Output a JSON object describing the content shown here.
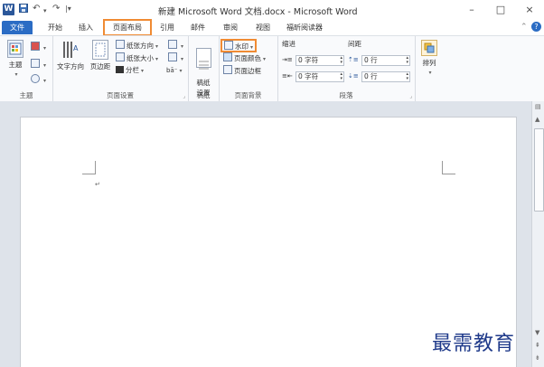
{
  "window": {
    "app_icon": "W",
    "title": "新建 Microsoft Word 文档.docx - Microsoft Word",
    "controls": {
      "minimize": "–",
      "maximize": "□",
      "close": "×"
    },
    "quick_access": {
      "save_icon": "save-icon",
      "undo": "↶",
      "dropdown": "|▾"
    }
  },
  "tabs": [
    {
      "label": "文件"
    },
    {
      "label": "开始"
    },
    {
      "label": "插入"
    },
    {
      "label": "页面布局"
    },
    {
      "label": "引用"
    },
    {
      "label": "邮件"
    },
    {
      "label": "审阅"
    },
    {
      "label": "视图"
    },
    {
      "label": "福昕阅读器"
    }
  ],
  "tab_right": {
    "collapse": "⌃",
    "help": "?"
  },
  "ribbon": {
    "theme": {
      "label": "主题",
      "button": "主题"
    },
    "page_setup": {
      "label": "页面设置",
      "text_direction": "文字方向",
      "margins": "页边距",
      "orientation": "纸张方向",
      "size": "纸张大小",
      "columns": "分栏"
    },
    "draft": {
      "label": "稿纸",
      "button": "稿纸\n设置"
    },
    "background": {
      "label": "页面背景",
      "watermark": "水印",
      "page_color": "页面颜色",
      "page_border": "页面边框"
    },
    "paragraph": {
      "label": "段落",
      "indent_title": "缩进",
      "spacing_title": "间距",
      "indent_left": "0 字符",
      "indent_right": "0 字符",
      "spacing_before": "0 行",
      "spacing_after": "0 行"
    },
    "arrange": {
      "button": "排列"
    }
  },
  "brand_text": "最需教育",
  "colors": {
    "accent": "#f08b33",
    "file_tab": "#2b6cc4",
    "brand": "#1f3a8a"
  }
}
